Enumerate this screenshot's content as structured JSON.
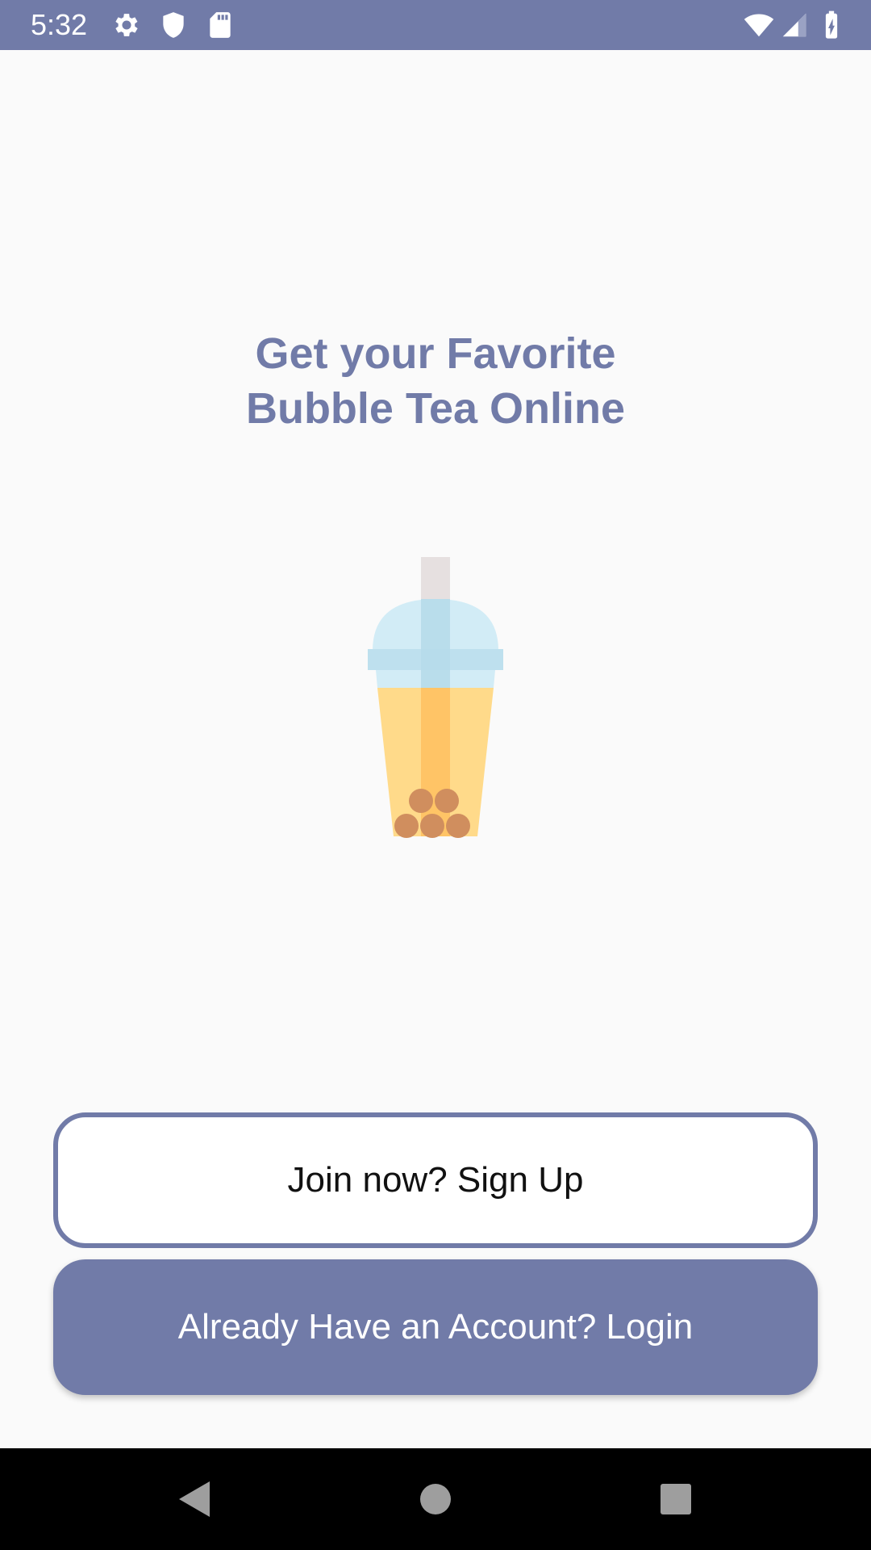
{
  "status_bar": {
    "time": "5:32",
    "background": "#717BA8",
    "left_icons": [
      "gear-icon",
      "shield-icon",
      "sd-card-icon"
    ],
    "right_icons": [
      "wifi-icon",
      "signal-icon",
      "battery-charging-icon"
    ]
  },
  "hero": {
    "headline_line1": "Get your Favorite",
    "headline_line2": "Bubble Tea Online",
    "headline_color": "#717BA8",
    "illustration": "bubble-tea-icon"
  },
  "actions": {
    "signup_label": "Join now? Sign Up",
    "login_label": "Already Have an Account? Login",
    "accent_color": "#717BA8"
  },
  "nav_bar": {
    "buttons": [
      "back-icon",
      "home-icon",
      "recents-icon"
    ]
  }
}
